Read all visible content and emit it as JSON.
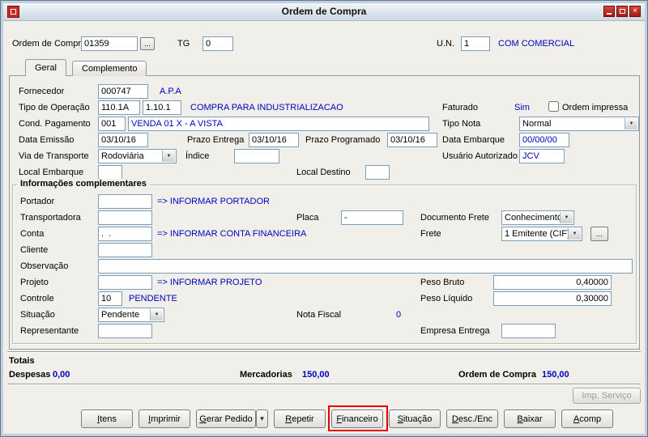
{
  "window": {
    "title": "Ordem de Compra"
  },
  "header": {
    "order_label": "Ordem de Compra",
    "order_value": "01359",
    "browse": "...",
    "tg_label": "TG",
    "tg_value": "0",
    "un_label": "U.N.",
    "un_value": "1",
    "un_name": "COM COMERCIAL"
  },
  "tabs": {
    "geral": "Geral",
    "complemento": "Complemento"
  },
  "geral": {
    "fornecedor_label": "Fornecedor",
    "fornecedor_code": "000747",
    "fornecedor_name": "A.P.A",
    "tipo_operacao_label": "Tipo de Operação",
    "tipo_operacao_code": "110.1A",
    "tipo_operacao_sub": "1.10.1",
    "tipo_operacao_desc": "COMPRA PARA INDUSTRIALIZACAO",
    "faturado_label": "Faturado",
    "faturado_value": "Sim",
    "ordem_impressa_label": "Ordem impressa",
    "cond_pagamento_label": "Cond. Pagamento",
    "cond_pagamento_code": "001",
    "cond_pagamento_desc": "VENDA 01 X - A VISTA",
    "tipo_nota_label": "Tipo Nota",
    "tipo_nota_value": "Normal",
    "data_emissao_label": "Data Emissão",
    "data_emissao_value": "03/10/16",
    "prazo_entrega_label": "Prazo Entrega",
    "prazo_entrega_value": "03/10/16",
    "prazo_programado_label": "Prazo Programado",
    "prazo_programado_value": "03/10/16",
    "data_embarque_label": "Data Embarque",
    "data_embarque_value": "00/00/00",
    "via_transporte_label": "Via de Transporte",
    "via_transporte_value": "Rodoviária",
    "indice_label": "Índice",
    "indice_value": "",
    "usuario_autorizado_label": "Usuário Autorizado",
    "usuario_autorizado_value": "JCV",
    "local_embarque_label": "Local Embarque",
    "local_embarque_value": "",
    "local_destino_label": "Local Destino",
    "local_destino_value": ""
  },
  "complementares": {
    "title": "Informações complementares",
    "portador_label": "Portador",
    "portador_value": "",
    "portador_hint": "=> INFORMAR PORTADOR",
    "transportadora_label": "Transportadora",
    "transportadora_value": "",
    "placa_label": "Placa",
    "placa_value": "-",
    "documento_frete_label": "Documento Frete",
    "documento_frete_value": "Conhecimento",
    "conta_label": "Conta",
    "conta_value": ".  .",
    "conta_hint": "=> INFORMAR CONTA FINANCEIRA",
    "frete_label": "Frete",
    "frete_value": "1 Emitente (CIF)",
    "frete_browse": "...",
    "cliente_label": "Cliente",
    "cliente_value": "",
    "observacao_label": "Observação",
    "observacao_value": "",
    "projeto_label": "Projeto",
    "projeto_value": "",
    "projeto_hint": "=> INFORMAR PROJETO",
    "peso_bruto_label": "Peso Bruto",
    "peso_bruto_value": "0,40000",
    "controle_label": "Controle",
    "controle_value": "10",
    "controle_status": "PENDENTE",
    "peso_liquido_label": "Peso Líquido",
    "peso_liquido_value": "0,30000",
    "situacao_label": "Situação",
    "situacao_value": "Pendente",
    "nota_fiscal_label": "Nota Fiscal",
    "nota_fiscal_value": "0",
    "representante_label": "Representante",
    "representante_value": "",
    "empresa_entrega_label": "Empresa Entrega",
    "empresa_entrega_value": ""
  },
  "totais": {
    "title": "Totais",
    "despesas_label": "Despesas",
    "despesas_value": "0,00",
    "mercadorias_label": "Mercadorias",
    "mercadorias_value": "150,00",
    "ordem_label": "Ordem de Compra",
    "ordem_value": "150,00"
  },
  "actions": {
    "imp_servico": "Imp. Serviço",
    "itens": "Itens",
    "imprimir": "Imprimir",
    "gerar_pedido": "Gerar Pedido",
    "repetir": "Repetir",
    "financeiro": "Financeiro",
    "situacao": "Situação",
    "desc_enc": "Desc./Enc",
    "baixar": "Baixar",
    "acomp": "Acomp"
  },
  "colors": {
    "value_blue": "#0000bb",
    "highlight_red": "#e80000"
  }
}
